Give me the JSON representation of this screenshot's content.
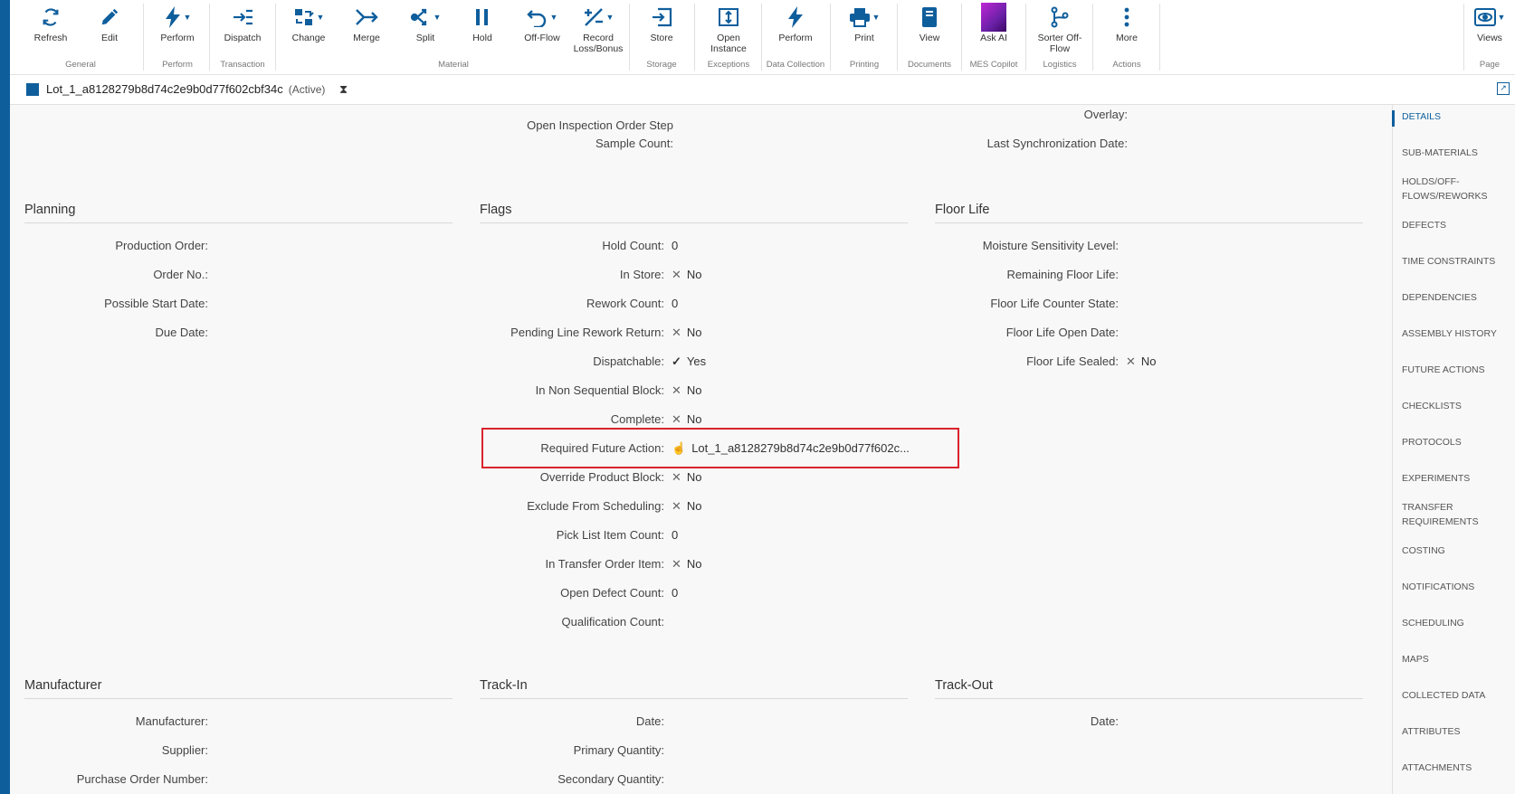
{
  "toolbar": {
    "buttons": [
      {
        "label": "Refresh",
        "icon": "refresh-icon"
      },
      {
        "label": "Edit",
        "icon": "edit-icon"
      },
      {
        "label": "Perform",
        "icon": "lightning-icon"
      },
      {
        "label": "Dispatch",
        "icon": "dispatch-icon"
      },
      {
        "label": "Change",
        "icon": "change-icon"
      },
      {
        "label": "Merge",
        "icon": "merge-icon"
      },
      {
        "label": "Split",
        "icon": "split-icon"
      },
      {
        "label": "Hold",
        "icon": "hold-icon"
      },
      {
        "label": "Off-Flow",
        "icon": "undo-icon"
      },
      {
        "label": "Record Loss/Bonus",
        "icon": "plus-minus-icon"
      },
      {
        "label": "Store",
        "icon": "store-icon"
      },
      {
        "label": "Open Instance",
        "icon": "open-instance-icon"
      },
      {
        "label": "Perform",
        "icon": "lightning-icon"
      },
      {
        "label": "Print",
        "icon": "printer-icon"
      },
      {
        "label": "View",
        "icon": "book-icon"
      },
      {
        "label": "Ask AI",
        "icon": "ai-icon"
      },
      {
        "label": "Sorter Off-Flow",
        "icon": "branch-icon"
      },
      {
        "label": "More",
        "icon": "more-icon"
      },
      {
        "label": "Views",
        "icon": "eye-icon"
      }
    ],
    "groups": [
      "General",
      "Perform",
      "Transaction",
      "Material",
      "Storage",
      "Exceptions",
      "Data Collection",
      "Printing",
      "Documents",
      "MES Copilot",
      "Logistics",
      "Actions",
      "Page"
    ]
  },
  "header": {
    "title": "Lot_1_a8128279b8d74c2e9b0d77f602cbf34c",
    "status": "(Active)",
    "hourglass": "⧗"
  },
  "top_partial": {
    "col2": [
      {
        "label": "Open Inspection Order Step"
      },
      {
        "label": "Sample Count:"
      }
    ],
    "col3": [
      {
        "label": "Overlay:"
      },
      {
        "label": "Last Synchronization Date:"
      }
    ]
  },
  "sections": {
    "planning": {
      "title": "Planning",
      "rows": [
        {
          "label": "Production Order:",
          "value": ""
        },
        {
          "label": "Order No.:",
          "value": ""
        },
        {
          "label": "Possible Start Date:",
          "value": ""
        },
        {
          "label": "Due Date:",
          "value": ""
        }
      ]
    },
    "flags": {
      "title": "Flags",
      "rows": [
        {
          "label": "Hold Count:",
          "value": "0"
        },
        {
          "label": "In Store:",
          "value": "No"
        },
        {
          "label": "Rework Count:",
          "value": "0"
        },
        {
          "label": "Pending Line Rework Return:",
          "value": "No"
        },
        {
          "label": "Dispatchable:",
          "value": "Yes"
        },
        {
          "label": "In Non Sequential Block:",
          "value": "No"
        },
        {
          "label": "Complete:",
          "value": "No"
        },
        {
          "label": "Required Future Action:",
          "value": "Lot_1_a8128279b8d74c2e9b0d77f602c..."
        },
        {
          "label": "Override Product Block:",
          "value": "No"
        },
        {
          "label": "Exclude From Scheduling:",
          "value": "No"
        },
        {
          "label": "Pick List Item Count:",
          "value": "0"
        },
        {
          "label": "In Transfer Order Item:",
          "value": "No"
        },
        {
          "label": "Open Defect Count:",
          "value": "0"
        },
        {
          "label": "Qualification Count:",
          "value": ""
        }
      ]
    },
    "floor_life": {
      "title": "Floor Life",
      "rows": [
        {
          "label": "Moisture Sensitivity Level:",
          "value": ""
        },
        {
          "label": "Remaining Floor Life:",
          "value": ""
        },
        {
          "label": "Floor Life Counter State:",
          "value": ""
        },
        {
          "label": "Floor Life Open Date:",
          "value": ""
        },
        {
          "label": "Floor Life Sealed:",
          "value": "No"
        }
      ]
    },
    "manufacturer": {
      "title": "Manufacturer",
      "rows": [
        {
          "label": "Manufacturer:",
          "value": ""
        },
        {
          "label": "Supplier:",
          "value": ""
        },
        {
          "label": "Purchase Order Number:",
          "value": ""
        }
      ]
    },
    "track_in": {
      "title": "Track-In",
      "rows": [
        {
          "label": "Date:",
          "value": ""
        },
        {
          "label": "Primary Quantity:",
          "value": ""
        },
        {
          "label": "Secondary Quantity:",
          "value": ""
        }
      ]
    },
    "track_out": {
      "title": "Track-Out",
      "rows": [
        {
          "label": "Date:",
          "value": ""
        }
      ]
    }
  },
  "right_nav": [
    "Details",
    "Sub-Materials",
    "Holds/Off-Flows/Reworks",
    "Defects",
    "Time Constraints",
    "Dependencies",
    "Assembly History",
    "Future Actions",
    "Checklists",
    "Protocols",
    "Experiments",
    "Transfer Requirements",
    "Costing",
    "Notifications",
    "Scheduling",
    "Maps",
    "Collected Data",
    "Attributes",
    "Attachments"
  ]
}
